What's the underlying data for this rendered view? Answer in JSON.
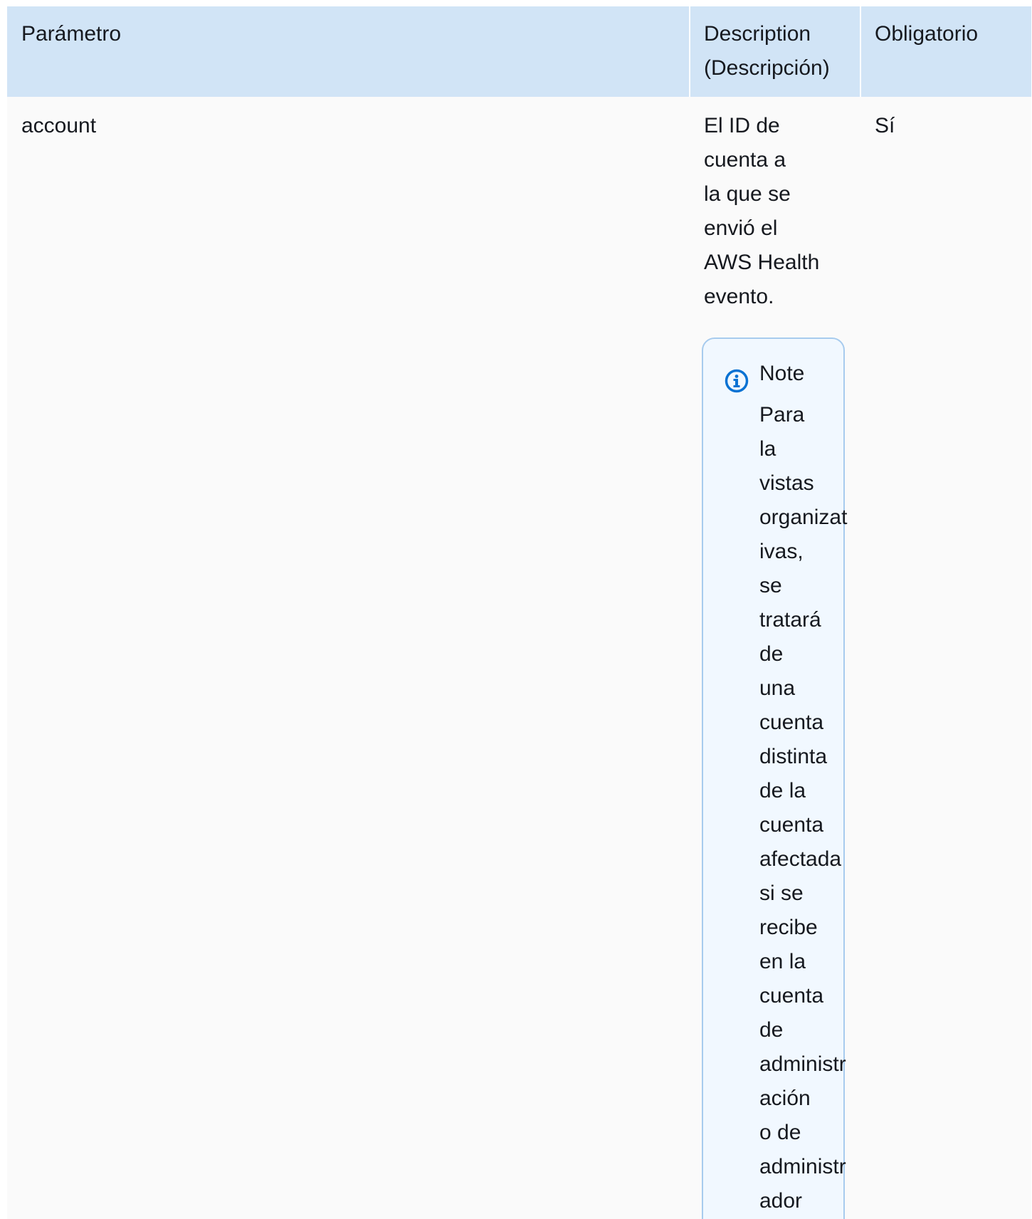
{
  "table": {
    "headers": {
      "parameter": "Parámetro",
      "description": "Description\n(Descripción)",
      "required": "Obligatorio"
    },
    "rows": [
      {
        "parameter": "account",
        "description": "El ID de\ncuenta a\nla que se\nenvió el\nAWS Health\nevento.",
        "required": "Sí",
        "note": {
          "icon": "info-icon",
          "title": "Note",
          "body": "Para\nla\nvistas\norganizat\nivas,\nse\ntratará\nde\nuna\ncuenta\ndistinta\nde la\ncuenta\nafectada\nsi se\nrecibe\nen la\ncuenta\nde\nadministr\nación\no de\nadministr\nador"
        }
      }
    ]
  },
  "colors": {
    "header_background": "#d1e4f6",
    "row_background": "#fafafa",
    "note_border": "#a7cbee",
    "note_background": "#f1f8ff",
    "info_icon": "#0972d3"
  }
}
